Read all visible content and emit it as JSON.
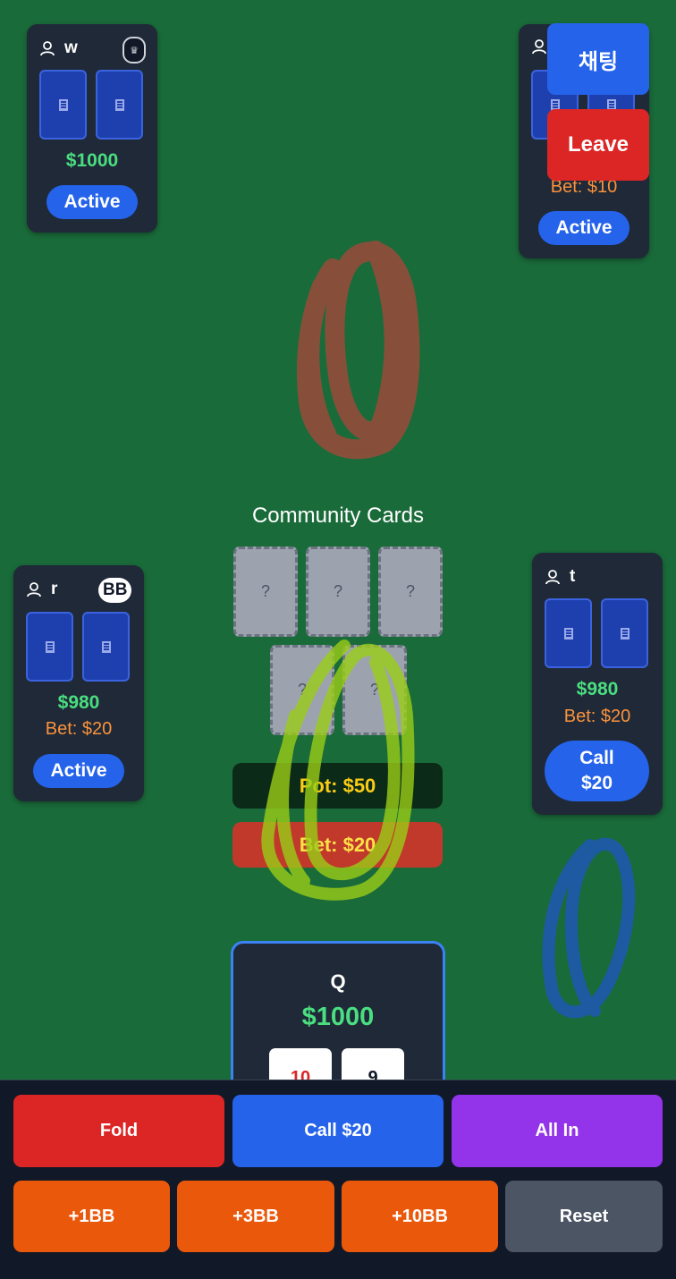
{
  "players": {
    "w": {
      "name": "w",
      "chips": "$1000",
      "status": "Active",
      "badge_icon": "crown-icon"
    },
    "topright": {
      "bet": "Bet: $10",
      "status": "Active"
    },
    "r": {
      "name": "r",
      "badge": "BB",
      "chips": "$980",
      "bet": "Bet: $20",
      "status": "Active"
    },
    "t": {
      "name": "t",
      "chips": "$980",
      "bet": "Bet: $20",
      "status_line1": "Call",
      "status_line2": "$20"
    }
  },
  "header": {
    "chat_label": "채팅",
    "leave_label": "Leave"
  },
  "community": {
    "title": "Community Cards",
    "cards": [
      "?",
      "?",
      "?",
      "?",
      "?"
    ]
  },
  "pot": {
    "label": "Pot: $50",
    "bet": "Bet: $20"
  },
  "you": {
    "name": "Q",
    "chips": "$1000",
    "cards": [
      "10",
      "9"
    ]
  },
  "actions": {
    "fold": "Fold",
    "call": "Call $20",
    "allin": "All In",
    "plus1": "+1BB",
    "plus3": "+3BB",
    "plus10": "+10BB",
    "reset": "Reset"
  },
  "colors": {
    "table": "#1a6b3a",
    "panel": "#1f2937",
    "chips": "#4ade80",
    "bet": "#fb923c",
    "primary": "#2563eb",
    "danger": "#dc2626",
    "purple": "#9333ea",
    "orange": "#ea580c",
    "gray": "#4b5563"
  }
}
